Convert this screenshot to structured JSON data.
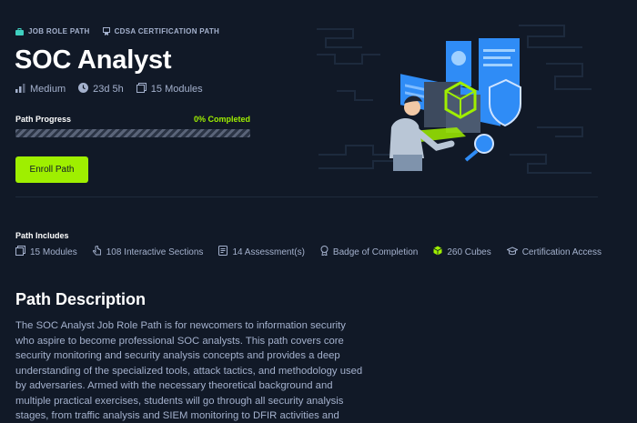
{
  "tags": [
    {
      "label": "JOB ROLE PATH",
      "icon": "briefcase-icon"
    },
    {
      "label": "CDSA CERTIFICATION PATH",
      "icon": "certificate-icon"
    }
  ],
  "title": "SOC Analyst",
  "meta": {
    "difficulty": "Medium",
    "duration": "23d 5h",
    "modules": "15 Modules"
  },
  "progress": {
    "label": "Path Progress",
    "value_text": "0% Completed",
    "fraction": 0
  },
  "enroll_label": "Enroll Path",
  "includes": {
    "title": "Path Includes",
    "items": [
      {
        "label": "15 Modules",
        "icon": "modules-icon"
      },
      {
        "label": "108 Interactive Sections",
        "icon": "interactive-icon"
      },
      {
        "label": "14 Assessment(s)",
        "icon": "assessment-icon"
      },
      {
        "label": "Badge of Completion",
        "icon": "badge-icon"
      },
      {
        "label": "260 Cubes",
        "icon": "cube-icon"
      },
      {
        "label": "Certification Access",
        "icon": "graduation-cap-icon"
      }
    ]
  },
  "description": {
    "title": "Path Description",
    "text": "The SOC Analyst Job Role Path is for newcomers to information security who aspire to become professional SOC analysts. This path covers core security monitoring and security analysis concepts and provides a deep understanding of the specialized tools, attack tactics, and methodology used by adversaries. Armed with the necessary theoretical background and multiple practical exercises, students will go through all security analysis stages, from traffic analysis and SIEM monitoring to DFIR activities and"
  },
  "colors": {
    "background": "#111927",
    "accent": "#9fef00",
    "text": "#a4b1cd",
    "illustration_blue": "#2f8cf6"
  }
}
